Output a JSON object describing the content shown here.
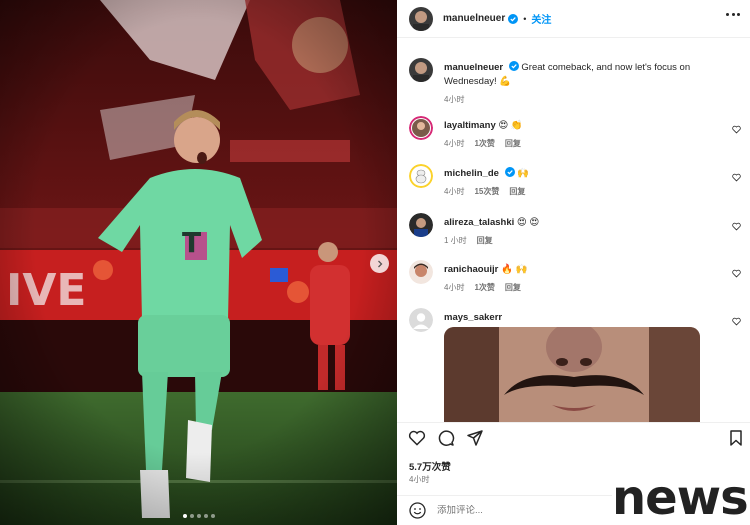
{
  "post": {
    "author": "manuelneuer",
    "separator": "•",
    "follow_label": "关注",
    "caption": "Great comeback, and now let's focus on Wednesday! 💪",
    "caption_time": "4小时",
    "image": {
      "subject": "goalkeeper-celebrating",
      "slide_count": 5,
      "active_slide": 1
    }
  },
  "comments": [
    {
      "user": "layaltimany",
      "text": "😍 👏",
      "verified": false,
      "time": "4小时",
      "likes": "1次赞",
      "reply": "回复"
    },
    {
      "user": "michelin_de",
      "text": "🙌",
      "verified": true,
      "time": "4小时",
      "likes": "15次赞",
      "reply": "回复"
    },
    {
      "user": "alireza_talashki",
      "text": "😍 😍",
      "verified": false,
      "time": "1 小时",
      "likes": "",
      "reply": "回复"
    },
    {
      "user": "ranichaouijr",
      "text": "🔥 🙌",
      "verified": false,
      "time": "4小时",
      "likes": "1次赞",
      "reply": "回复"
    },
    {
      "user": "mays_sakerr",
      "text": "",
      "verified": false,
      "time": "",
      "likes": "",
      "reply": ""
    }
  ],
  "stats": {
    "likes": "5.7万次赞",
    "time": "4小时"
  },
  "add_comment": {
    "placeholder": "添加评论..."
  },
  "watermark": "news",
  "icons": [
    "more-icon",
    "verified-icon",
    "heart-icon",
    "comment-icon",
    "share-icon",
    "bookmark-icon",
    "emoji-icon",
    "chevron-right-icon"
  ],
  "colors": {
    "accent": "#0095f6",
    "kit_green": "#6fd8a3",
    "stadium_red": "#b01a1a"
  }
}
